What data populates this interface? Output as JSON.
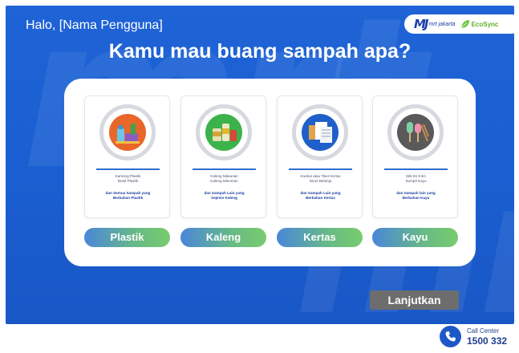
{
  "greeting": "Halo, [Nama Pengguna]",
  "title": "Kamu mau buang sampah apa?",
  "brand": {
    "mrt_mark": "MJ",
    "mrt_text": "mrt jakarta",
    "eco_name": "EcoSync"
  },
  "watermark": "mrt",
  "categories": [
    {
      "label": "Plastik",
      "desc": "Kantong Plastik\nBotol Plastik",
      "note": "dan Semua Sampah yang\nBerbahan Plastik",
      "icon": "plastic-waste-icon",
      "color": "#e8662a"
    },
    {
      "label": "Kaleng",
      "desc": "Kaleng Makanan\nKaleng Minuman",
      "note": "dan Sampah Lain yang\nSejenis Kaleng",
      "icon": "can-waste-icon",
      "color": "#3cb24a"
    },
    {
      "label": "Kertas",
      "desc": "Kardus atau Tiket Kertas\nDirus Belanja",
      "note": "dan Sampah Lain yang\nBerbahan Kertas",
      "icon": "paper-waste-icon",
      "color": "#1f5fc9"
    },
    {
      "label": "Kayu",
      "desc": "Stik Es Krim\nSumpit Kayu",
      "note": "dan Sampah lain yang\nBerbahan Kayu",
      "icon": "wood-waste-icon",
      "color": "#5a5a5a"
    }
  ],
  "next_label": "Lanjutkan",
  "call_center": {
    "label": "Call Center",
    "number": "1500 332"
  }
}
